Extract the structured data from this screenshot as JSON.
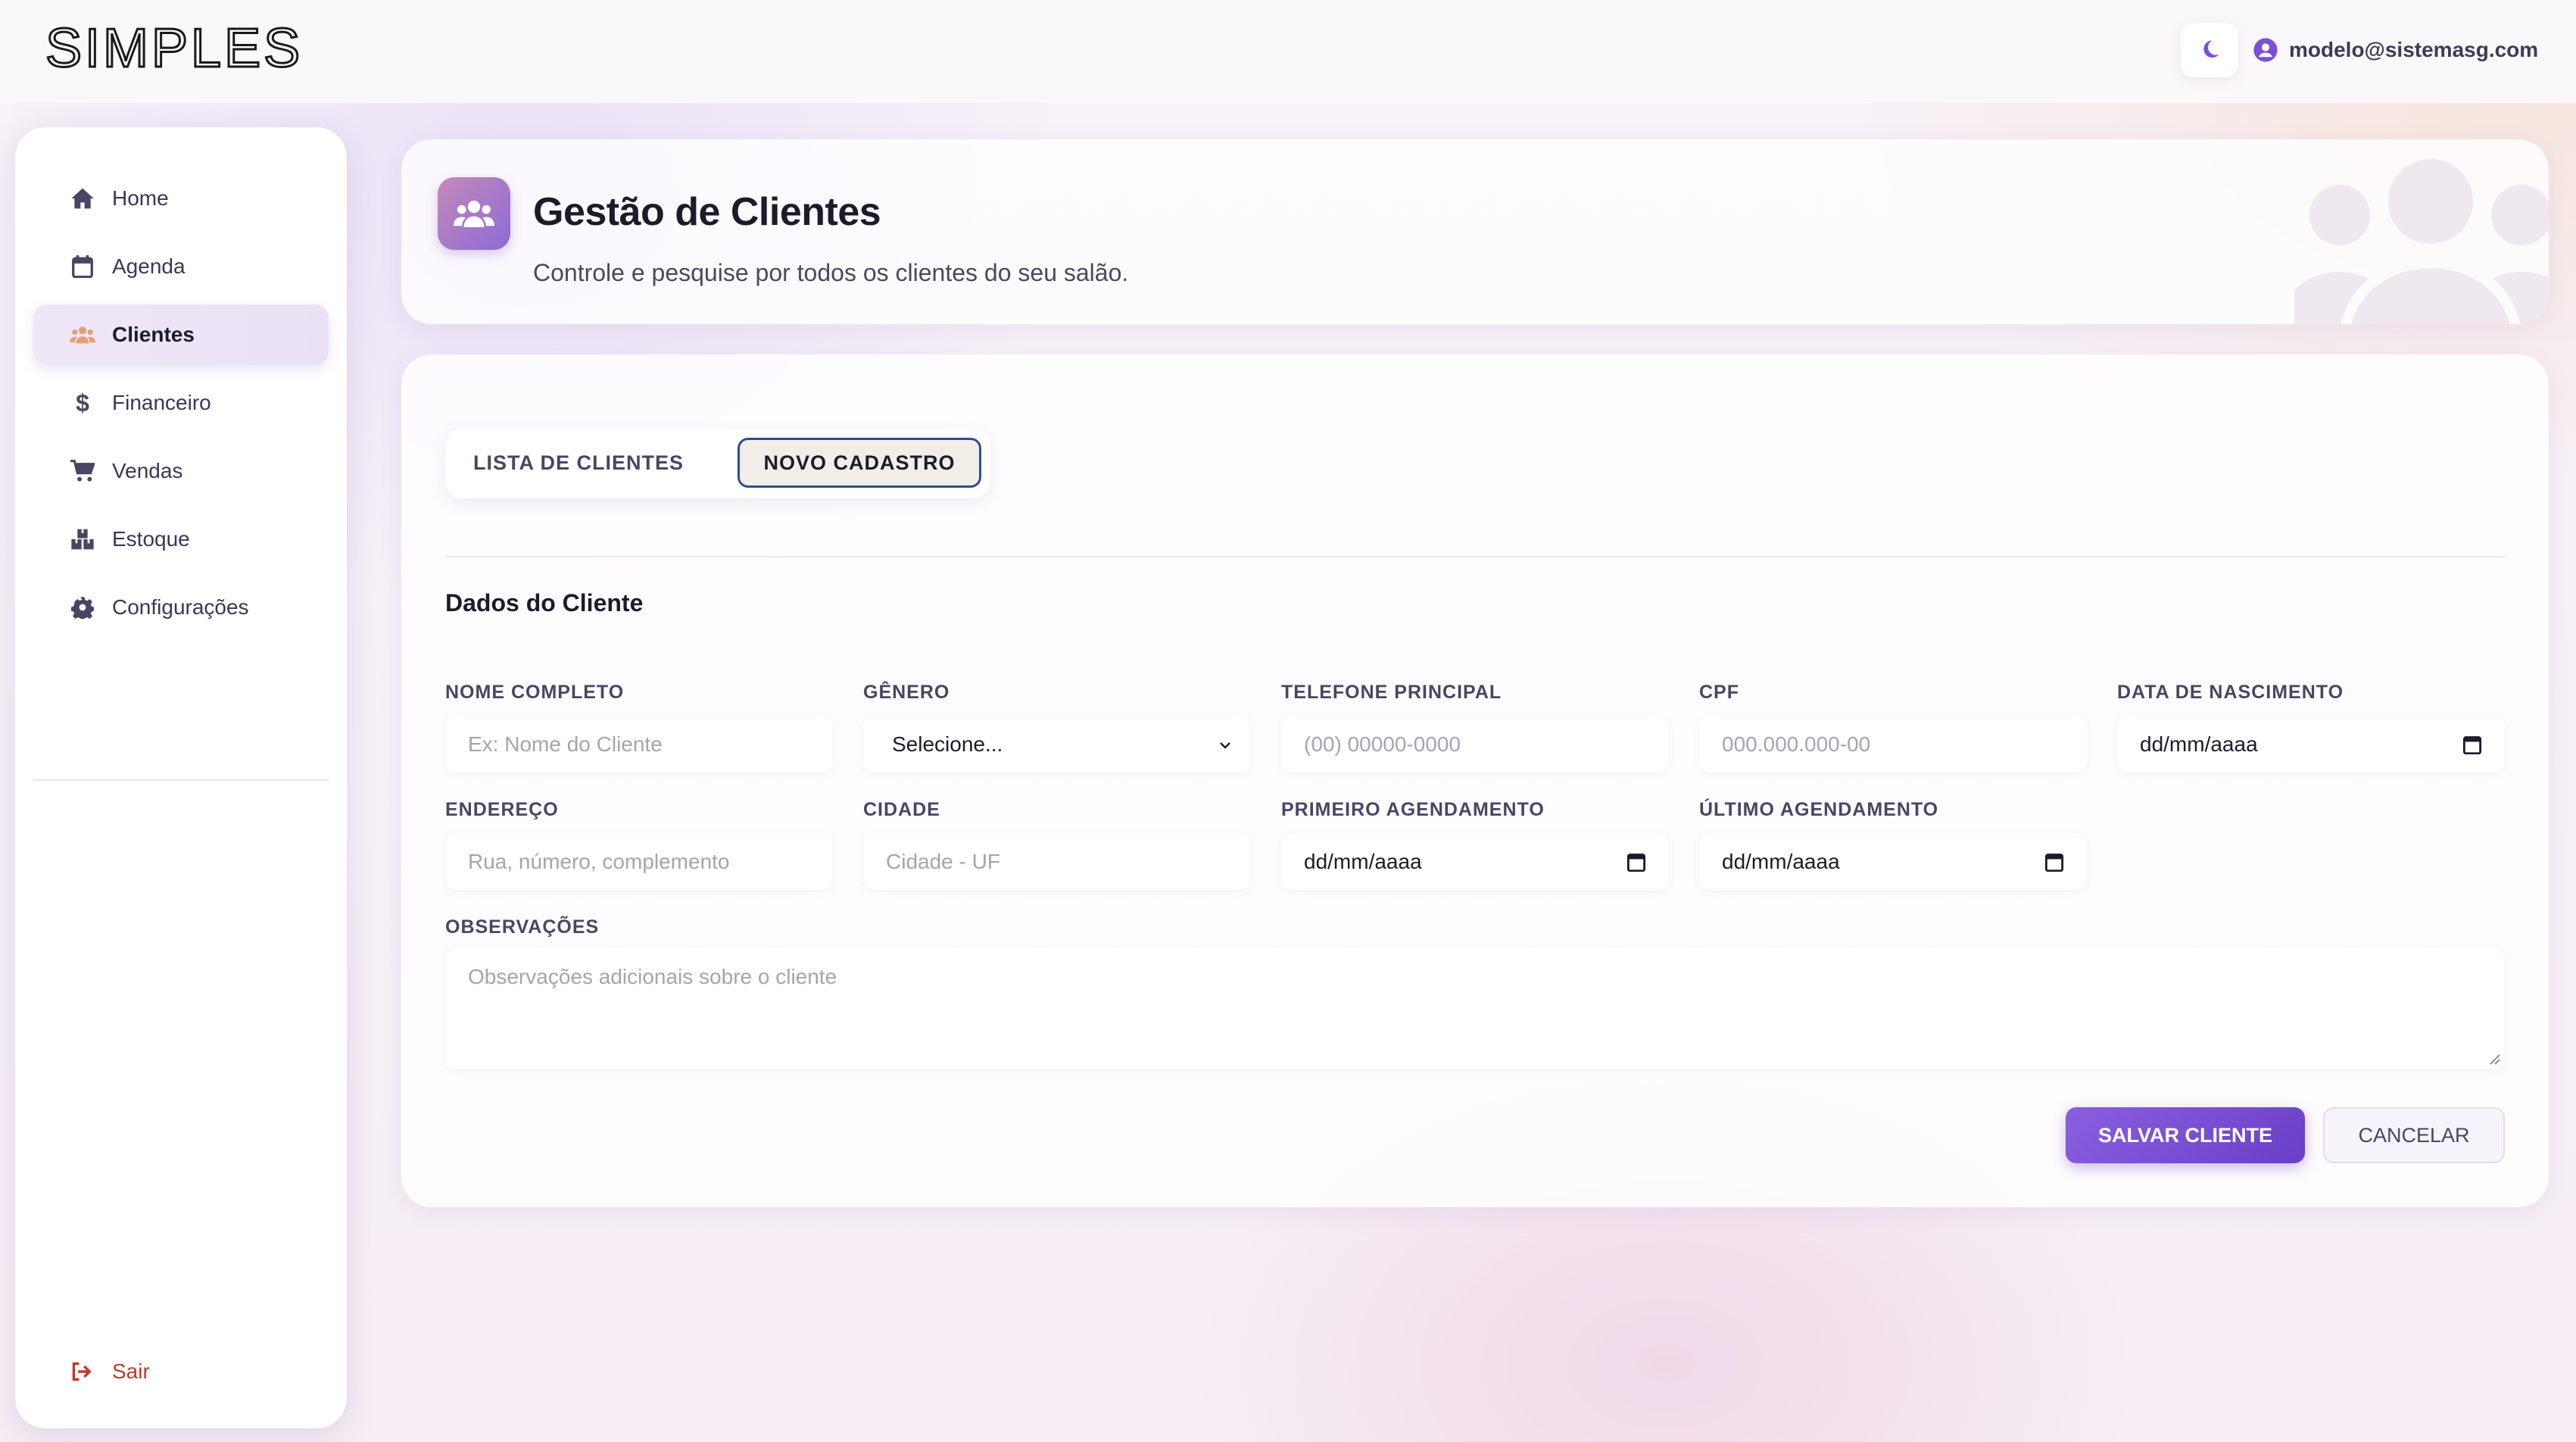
{
  "app": {
    "logo_text": "SIMPLES",
    "user_email": "modelo@sistemasg.com"
  },
  "sidebar": {
    "items": [
      {
        "label": "Home",
        "icon": "home-icon",
        "active": false
      },
      {
        "label": "Agenda",
        "icon": "calendar-icon",
        "active": false
      },
      {
        "label": "Clientes",
        "icon": "users-icon",
        "active": true
      },
      {
        "label": "Financeiro",
        "icon": "dollar-icon",
        "active": false
      },
      {
        "label": "Vendas",
        "icon": "cart-icon",
        "active": false
      },
      {
        "label": "Estoque",
        "icon": "boxes-icon",
        "active": false
      },
      {
        "label": "Configurações",
        "icon": "gear-icon",
        "active": false
      }
    ],
    "logout_label": "Sair"
  },
  "header": {
    "title": "Gestão de Clientes",
    "subtitle": "Controle e pesquise por todos os clientes do seu salão."
  },
  "tabs": {
    "list_label": "LISTA DE CLIENTES",
    "new_label": "NOVO CADASTRO",
    "active": "NOVO CADASTRO"
  },
  "form": {
    "section_title": "Dados do Cliente",
    "nome": {
      "label": "NOME COMPLETO",
      "placeholder": "Ex: Nome do Cliente"
    },
    "genero": {
      "label": "GÊNERO",
      "value": "Selecione..."
    },
    "telefone": {
      "label": "TELEFONE PRINCIPAL",
      "placeholder": "(00) 00000-0000"
    },
    "cpf": {
      "label": "CPF",
      "placeholder": "000.000.000-00"
    },
    "nascimento": {
      "label": "DATA DE NASCIMENTO",
      "value": "dd/mm/aaaa"
    },
    "endereco": {
      "label": "ENDEREÇO",
      "placeholder": "Rua, número, complemento"
    },
    "cidade": {
      "label": "CIDADE",
      "placeholder": "Cidade - UF"
    },
    "primeiro": {
      "label": "PRIMEIRO AGENDAMENTO",
      "value": "dd/mm/aaaa"
    },
    "ultimo": {
      "label": "ÚLTIMO AGENDAMENTO",
      "value": "dd/mm/aaaa"
    },
    "observacoes": {
      "label": "OBSERVAÇÕES",
      "placeholder": "Observações adicionais sobre o cliente"
    },
    "save_label": "SALVAR CLIENTE",
    "cancel_label": "CANCELAR"
  },
  "colors": {
    "accent": "#7b4fd6",
    "active_tab_border": "#2b4f93",
    "logout": "#c0392b"
  }
}
